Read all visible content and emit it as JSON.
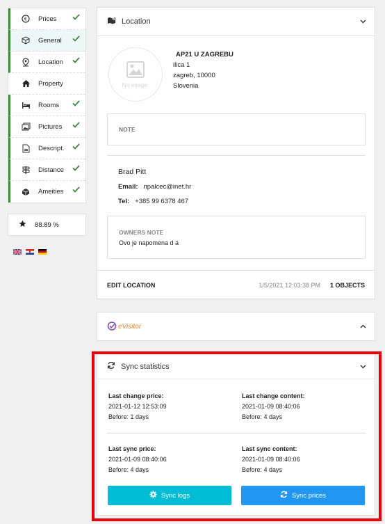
{
  "nav": {
    "items": [
      {
        "label": "Prices",
        "icon": "euro-icon",
        "done": true
      },
      {
        "label": "General",
        "icon": "cube-outline-icon",
        "done": true,
        "active": true
      },
      {
        "label": "Location",
        "icon": "map-pin-icon",
        "done": true
      },
      {
        "label": "Property",
        "icon": "house-icon",
        "done": false
      },
      {
        "label": "Rooms",
        "icon": "bed-icon",
        "done": true
      },
      {
        "label": "Pictures",
        "icon": "pictures-icon",
        "done": true
      },
      {
        "label": "Descript.",
        "icon": "document-icon",
        "done": true
      },
      {
        "label": "Distance",
        "icon": "signpost-icon",
        "done": true
      },
      {
        "label": "Ameities",
        "icon": "box-icon",
        "done": true
      }
    ]
  },
  "rating": {
    "value": "88.89 %"
  },
  "languages": [
    "English",
    "Croatian",
    "German"
  ],
  "location": {
    "title": "Location",
    "no_image": "No image.",
    "name": "AP21 U ZAGREBU",
    "street": "ilica 1",
    "city": "zagreb, 10000",
    "country": "Slovenia",
    "note_label": "NOTE",
    "owner_name": "Brad Pitt",
    "email_label": "Email:",
    "email": "npalcec@inet.hr",
    "tel_label": "Tel:",
    "tel": "+385 99 6378 467",
    "owners_note_label": "OWNERS NOTE",
    "owners_note": "Ovo je napomena d a",
    "edit_label": "EDIT LOCATION",
    "timestamp": "1/5/2021 12:03:38 PM",
    "objects": "1 OBJECTS"
  },
  "evisitor": {
    "brand": "eVisitor"
  },
  "sync": {
    "title": "Sync statistics",
    "last_change_price_label": "Last change price:",
    "last_change_price_date": "2021-01-12 12:53:09",
    "last_change_price_before": "Before: 1 days",
    "last_change_content_label": "Last change content:",
    "last_change_content_date": "2021-01-09 08:40:06",
    "last_change_content_before": "Before: 4 days",
    "last_sync_price_label": "Last sync price:",
    "last_sync_price_date": "2021-01-09 08:40:06",
    "last_sync_price_before": "Before: 4 days",
    "last_sync_content_label": "Last sync content:",
    "last_sync_content_date": "2021-01-09 08:40:06",
    "last_sync_content_before": "Before: 4 days",
    "sync_logs_label": "Sync logs",
    "sync_prices_label": "Sync prices"
  },
  "colors": {
    "check": "#3a8a3a",
    "cyan": "#00bcd4",
    "blue": "#2196f3",
    "highlight": "#e8000b"
  }
}
